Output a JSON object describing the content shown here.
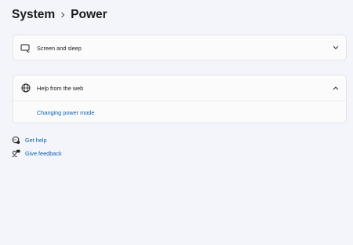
{
  "breadcrumb": {
    "parent": "System",
    "current": "Power"
  },
  "cards": {
    "screen_sleep": {
      "title": "Screen and sleep",
      "expanded": false,
      "icon": "screen-sleep-icon"
    },
    "help_web": {
      "title": "Help from the web",
      "expanded": true,
      "icon": "globe-icon",
      "links": [
        "Changing power mode"
      ]
    }
  },
  "footer": {
    "get_help": "Get help",
    "give_feedback": "Give feedback"
  },
  "colors": {
    "background": "#f3f5fa",
    "card": "#fbfbfb",
    "link": "#0f5fad"
  }
}
